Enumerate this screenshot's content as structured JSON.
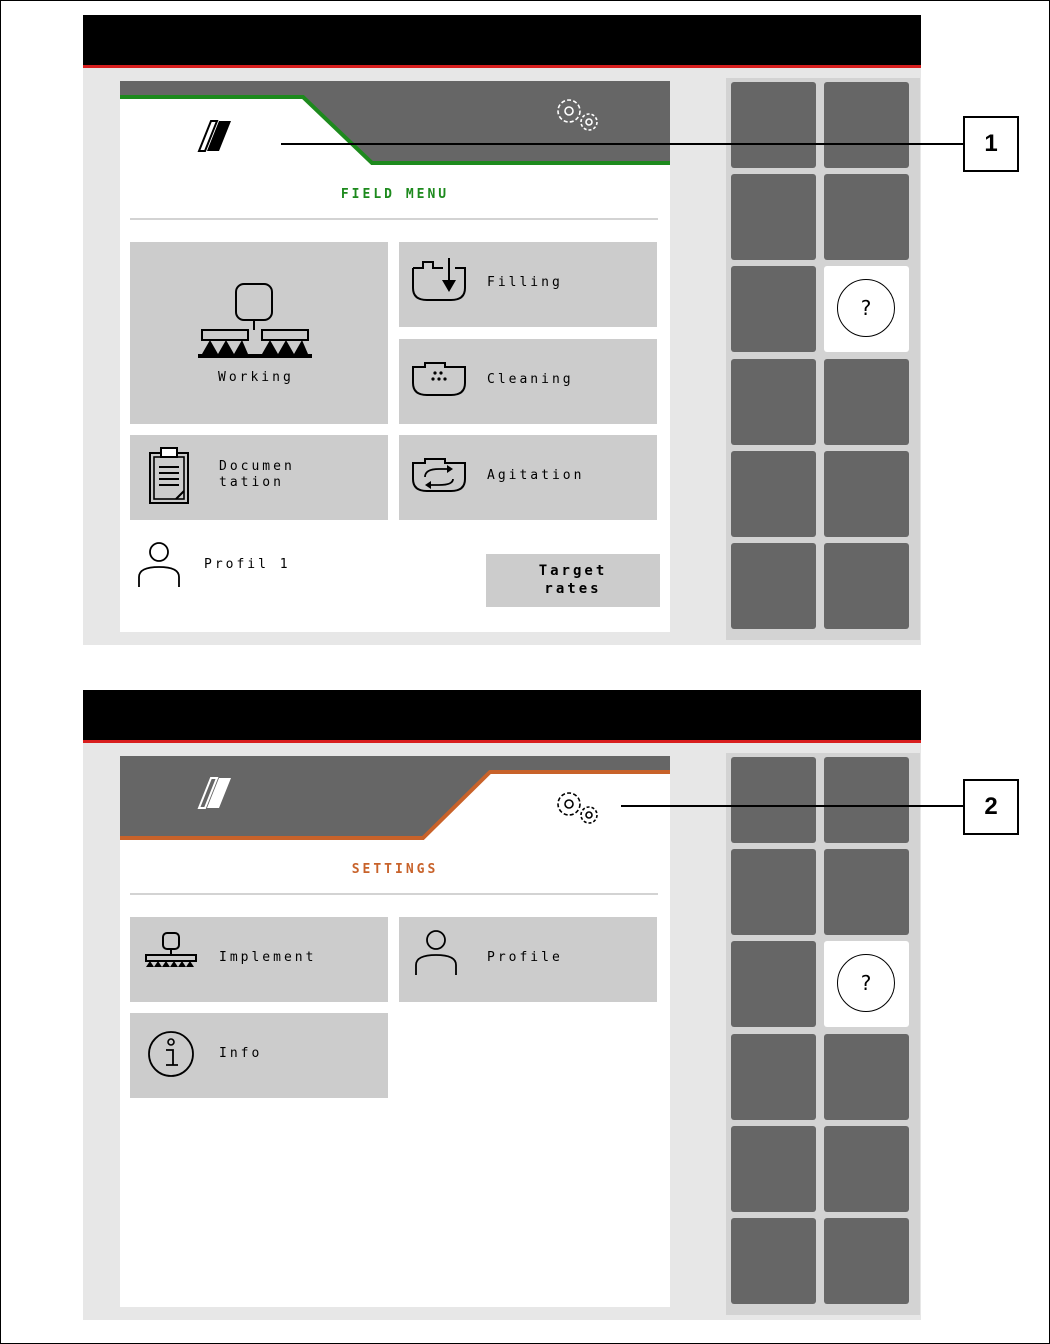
{
  "screen1": {
    "title": "FIELD MENU",
    "title_color": "#1d8a1d",
    "active_tab": "field-menu",
    "tiles": {
      "working": "Working",
      "filling": "Filling",
      "cleaning": "Cleaning",
      "documentation": "Documen\ntation",
      "agitation": "Agitation"
    },
    "profile": "Profil 1",
    "target_rates": "Target\nrates",
    "callout": "1"
  },
  "screen2": {
    "title": "SETTINGS",
    "title_color": "#c8622a",
    "active_tab": "settings",
    "tiles": {
      "implement": "Implement",
      "profile": "Profile",
      "info": "Info"
    },
    "callout": "2"
  },
  "sidebar": {
    "help_symbol": "?"
  },
  "colors": {
    "topbar": "#000000",
    "topbar_accent": "#d81e1e",
    "tab_inactive": "#666666",
    "tile": "#cccccc",
    "sidebar_button": "#666666"
  }
}
